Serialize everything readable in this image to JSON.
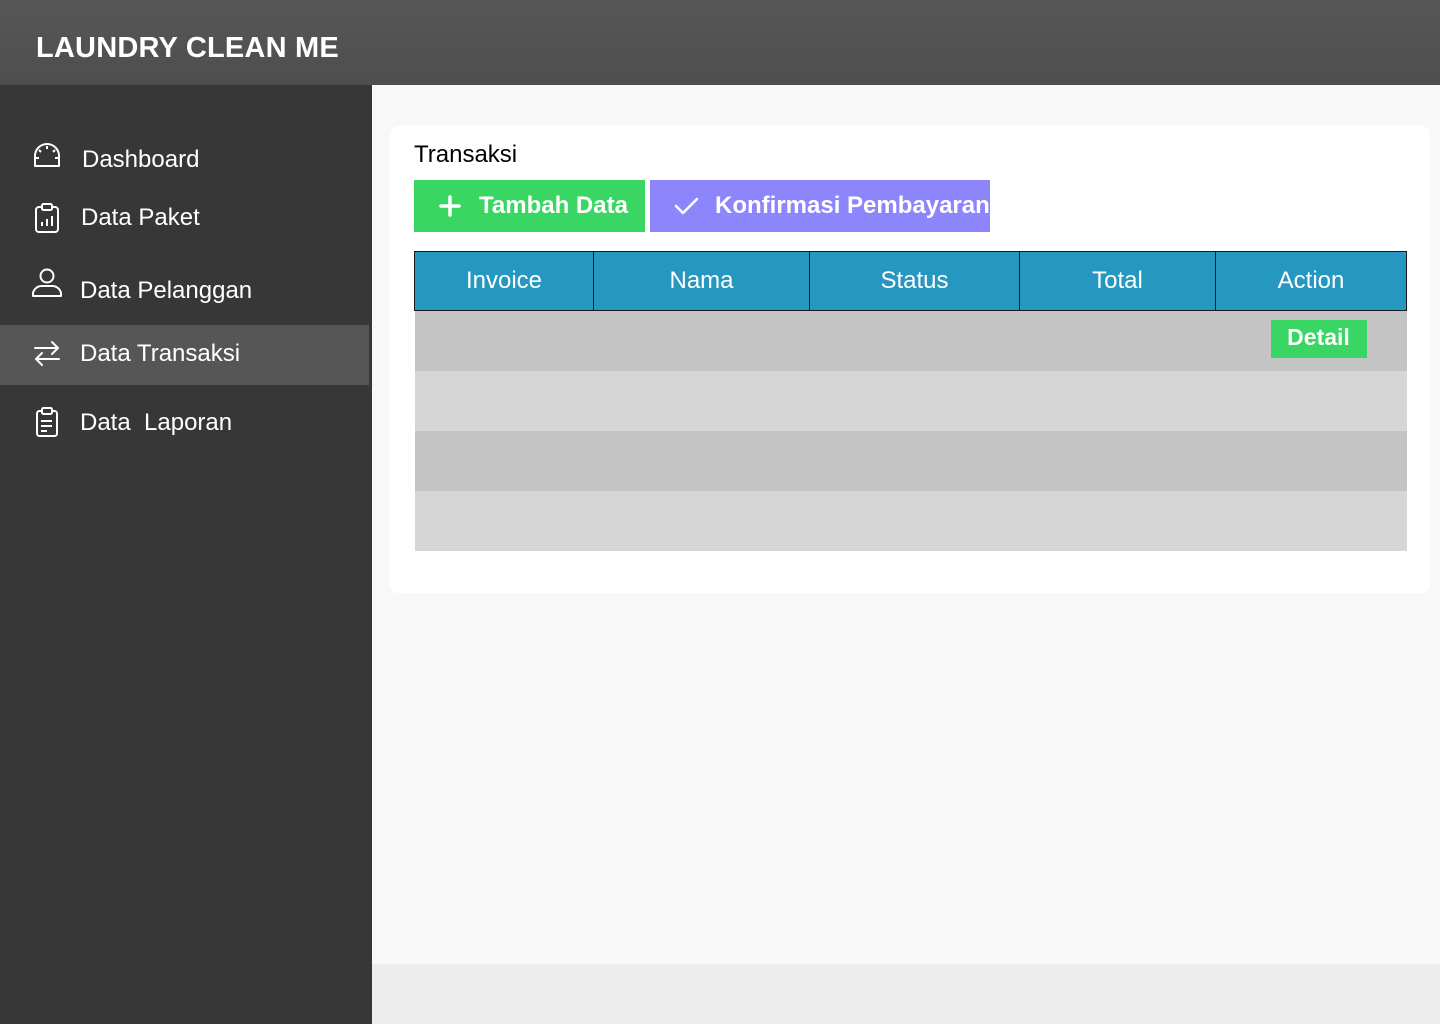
{
  "app": {
    "title": "LAUNDRY CLEAN ME"
  },
  "sidebar": {
    "items": [
      {
        "label": "Dashboard",
        "icon": "dashboard-gauge-icon",
        "active": false
      },
      {
        "label": "Data Paket",
        "icon": "clipboard-chart-icon",
        "active": false
      },
      {
        "label": "Data Pelanggan",
        "icon": "user-icon",
        "active": false
      },
      {
        "label": "Data Transaksi",
        "icon": "transfer-arrows-icon",
        "active": true
      },
      {
        "label": "Data  Laporan",
        "icon": "report-clipboard-icon",
        "active": false
      }
    ]
  },
  "main": {
    "title": "Transaksi",
    "buttons": {
      "add_label": "Tambah Data",
      "confirm_label": "Konfirmasi Pembayaran"
    },
    "table": {
      "columns": [
        "Invoice",
        "Nama",
        "Status",
        "Total",
        "Action"
      ],
      "rows": [
        {
          "invoice": "",
          "nama": "",
          "status": "",
          "total": "",
          "action": "Detail"
        },
        {
          "invoice": "",
          "nama": "",
          "status": "",
          "total": "",
          "action": ""
        },
        {
          "invoice": "",
          "nama": "",
          "status": "",
          "total": "",
          "action": ""
        },
        {
          "invoice": "",
          "nama": "",
          "status": "",
          "total": "",
          "action": ""
        }
      ]
    }
  },
  "colors": {
    "header": "#525252",
    "sidebar": "#373737",
    "sidebar_active": "#565656",
    "add_button": "#3ad664",
    "confirm_button": "#8c85fb",
    "table_header": "#2697c0",
    "row_dark": "#c4c4c4",
    "row_light": "#d6d6d6"
  }
}
